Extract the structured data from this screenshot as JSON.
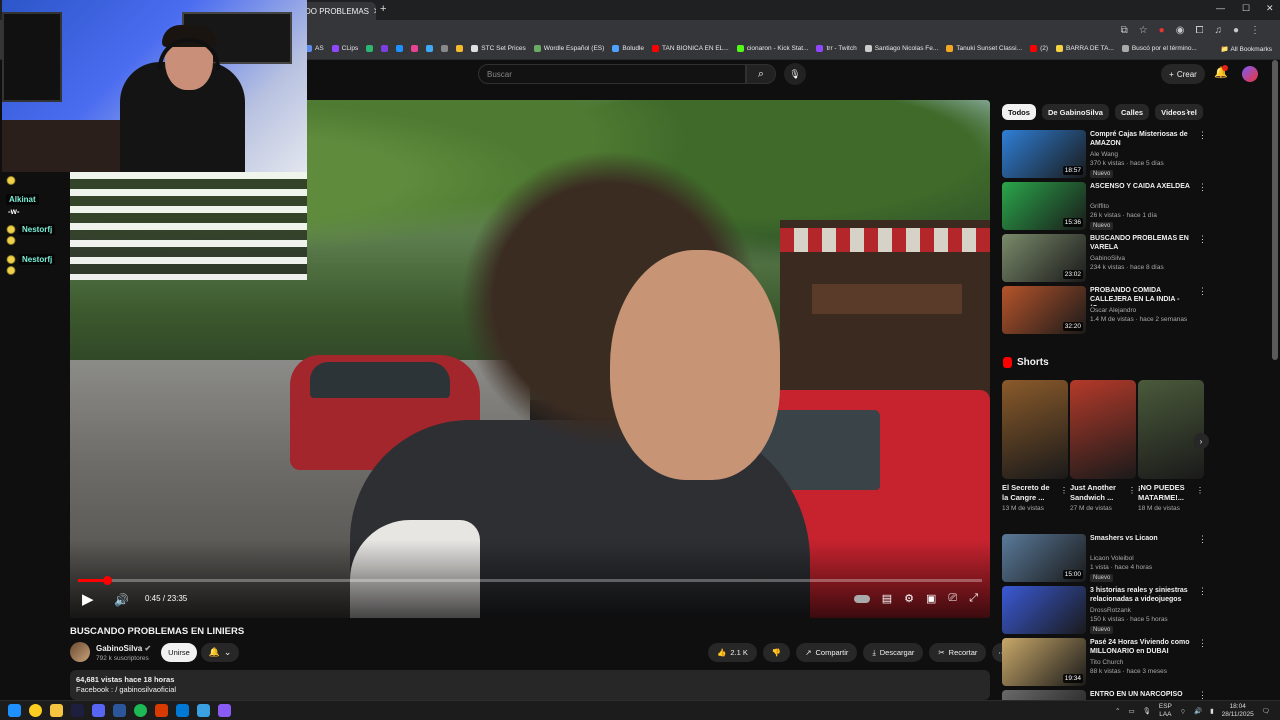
{
  "browser": {
    "tab_title": "DO PROBLEMAS",
    "bookmarks": [
      {
        "label": "AS",
        "color": "#5a8dee"
      },
      {
        "label": "CLips",
        "color": "#9147ff"
      },
      {
        "label": "",
        "color": "#2bb673"
      },
      {
        "label": "",
        "color": "#7b3fe4"
      },
      {
        "label": "",
        "color": "#1e90ff"
      },
      {
        "label": "",
        "color": "#e84393"
      },
      {
        "label": "",
        "color": "#3fa9f5"
      },
      {
        "label": "",
        "color": "#888888"
      },
      {
        "label": "",
        "color": "#f3ba2f"
      },
      {
        "label": "STC Set Prices",
        "color": "#e0e0e0"
      },
      {
        "label": "Wordle Español (ES)",
        "color": "#6aaa64"
      },
      {
        "label": "Boludle",
        "color": "#4da3ff"
      },
      {
        "label": "TAN BIONICA EN EL...",
        "color": "#ff0000"
      },
      {
        "label": "cionaron - Kick Stat...",
        "color": "#53fc18"
      },
      {
        "label": "trr - Twitch",
        "color": "#9147ff"
      },
      {
        "label": "Santiago Nicolas Fe...",
        "color": "#cccccc"
      },
      {
        "label": "Tanuki Sunset Classi...",
        "color": "#f5a623"
      },
      {
        "label": "(2)",
        "color": "#ff0000"
      },
      {
        "label": "BARRA DE TA...",
        "color": "#f5d142"
      },
      {
        "label": "Buscó por el término...",
        "color": "#aaaaaa"
      }
    ],
    "all_bookmarks": "All Bookmarks"
  },
  "header": {
    "search_placeholder": "Buscar",
    "create_label": "Crear"
  },
  "player": {
    "current_time": "0:45",
    "duration": "23:35",
    "time_label": "0:45 / 23:35",
    "progress": 0.032
  },
  "overlay": {
    "chat": {
      "lines": [
        {
          "type": "emote"
        },
        {
          "type": "user",
          "name": "Alkinat"
        },
        {
          "type": "msg",
          "text": "-w-"
        },
        {
          "type": "user_emote",
          "name": "Nestorfj"
        },
        {
          "type": "user_emote",
          "name": "Nestorfj"
        }
      ]
    }
  },
  "video": {
    "title": "BUSCANDO PROBLEMAS EN LINIERS",
    "channel": "GabinoSilva",
    "subscribers": "792 k suscriptores",
    "join_label": "Unirse",
    "likes": "2.1 K",
    "share_label": "Compartir",
    "download_label": "Descargar",
    "clip_label": "Recortar",
    "views_line": "64,681 vistas  hace 18 horas",
    "facebook_line": "Facebook :   / gabinosilvaoficial"
  },
  "sidebar": {
    "chips": [
      "Todos",
      "De GabinoSilva",
      "Calles",
      "Videos rel"
    ],
    "recs_top": [
      {
        "title": "Compré Cajas Misteriosas de AMAZON",
        "channel": "Ale Wang",
        "meta": "370 k vistas · hace 5 días",
        "duration": "18:57",
        "nuevo": "Nuevo",
        "color": "#2f7fd6"
      },
      {
        "title": "ASCENSO Y CAIDA AXELDEA",
        "channel": "Griffito",
        "meta": "26 k vistas · hace 1 día",
        "duration": "15:36",
        "nuevo": "Nuevo",
        "color": "#2aa64a"
      },
      {
        "title": "BUSCANDO PROBLEMAS EN VARELA",
        "channel": "GabinoSilva",
        "meta": "234 k vistas · hace 8 días",
        "duration": "23:02",
        "nuevo": "",
        "color": "#7a8a6a"
      },
      {
        "title": "PROBANDO COMIDA CALLEJERA EN LA INDIA - (Ca...",
        "channel": "Oscar Alejandro",
        "meta": "1.4 M de vistas · hace 2 semanas",
        "duration": "32:20",
        "nuevo": "",
        "color": "#b6542a"
      }
    ],
    "shorts_title": "Shorts",
    "shorts": [
      {
        "title": "El Secreto de la Cangre ...",
        "views": "13 M de vistas",
        "color": "#8a5a2a"
      },
      {
        "title": "Just Another Sandwich ...",
        "views": "27 M de vistas",
        "color": "#b43a2a"
      },
      {
        "title": "¡NO PUEDES MATARME!...",
        "views": "18 M de vistas",
        "color": "#4a5a3a"
      }
    ],
    "recs_bottom": [
      {
        "title": "Smashers vs Licaon",
        "channel": "Licaon Voleibol",
        "meta": "1 vista · hace 4 horas",
        "duration": "15:00",
        "nuevo": "Nuevo",
        "color": "#5a7a9a"
      },
      {
        "title": "3 historias reales y siniestras relacionadas a videojuegos",
        "channel": "DrossRotzank",
        "meta": "150 k vistas · hace 5 horas",
        "duration": "",
        "nuevo": "Nuevo",
        "color": "#3a5ad6"
      },
      {
        "title": "Pasé 24 Horas Viviendo como MILLONARIO en DUBAI",
        "channel": "Tito Church",
        "meta": "88 k vistas · hace 3 meses",
        "duration": "19:34",
        "nuevo": "",
        "color": "#c9a86a"
      },
      {
        "title": "ENTRO EN UN NARCOPISO EN ...",
        "channel": "",
        "meta": "",
        "duration": "",
        "nuevo": "",
        "color": "#6a6a6a"
      }
    ]
  },
  "taskbar": {
    "lang_1": "ESP",
    "lang_2": "LAA",
    "time": "18:04",
    "date": "28/11/2025"
  }
}
